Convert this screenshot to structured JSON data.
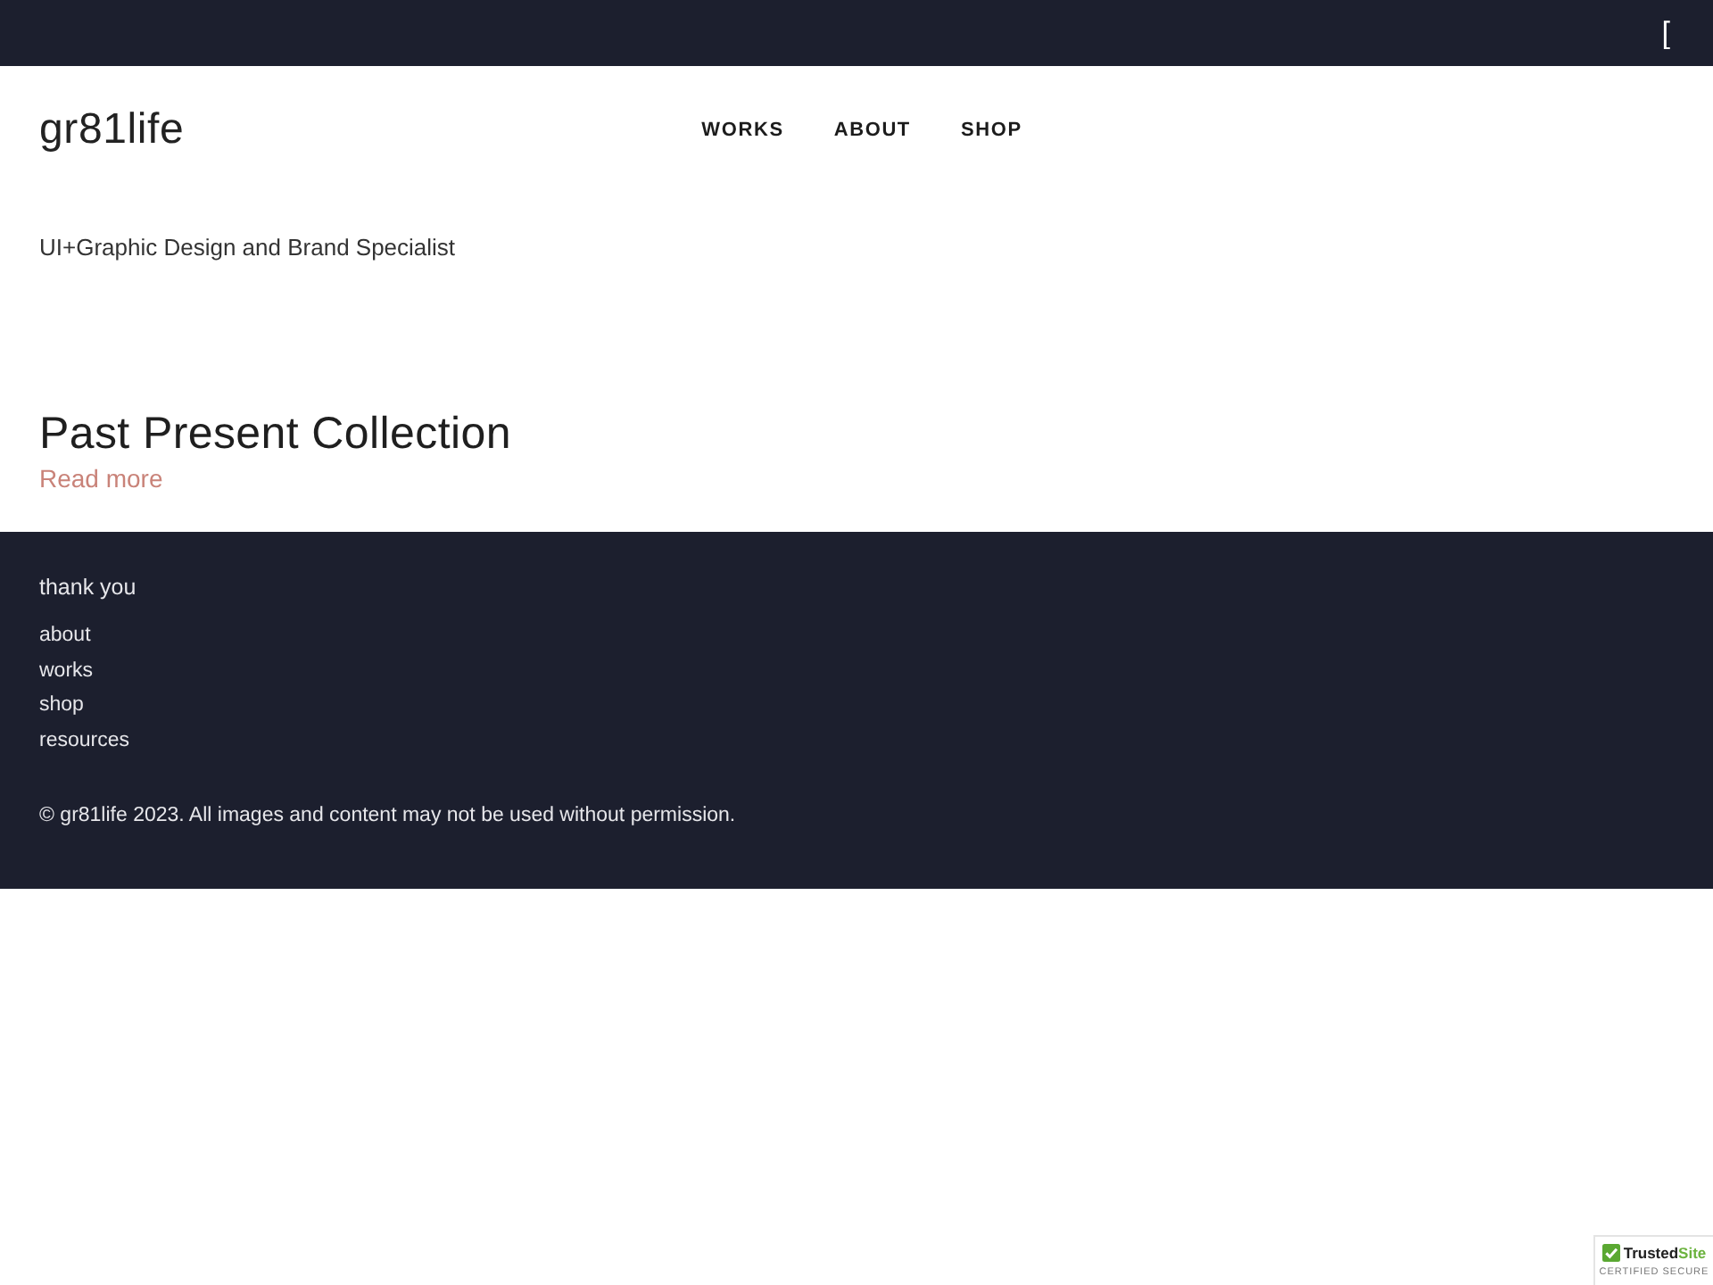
{
  "top_bar": {
    "icon_glyph": "["
  },
  "header": {
    "logo": "gr81life",
    "nav": [
      {
        "label": "WORKS"
      },
      {
        "label": "ABOUT"
      },
      {
        "label": "SHOP"
      }
    ]
  },
  "tagline": "UI+Graphic Design and Brand Specialist",
  "post": {
    "title": "Past Present Collection",
    "link": "Read more"
  },
  "footer": {
    "heading": "thank you",
    "links": [
      "about",
      "works",
      "shop",
      "resources"
    ],
    "copyright": "© gr81life 2023. All images and content may not be used without permission."
  },
  "badge": {
    "name": "Trusted",
    "name_accent": "Site",
    "caption": "CERTIFIED SECURE"
  }
}
